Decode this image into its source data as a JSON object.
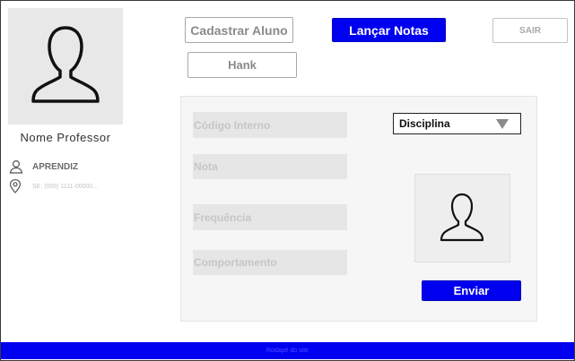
{
  "profile": {
    "name": "Nome Professor",
    "role": "APRENDIZ",
    "location": "SE: (000) 1111-00000..."
  },
  "buttons": {
    "cadastrar": "Cadastrar Aluno",
    "lancar": "Lançar Notas",
    "sair": "SAIR",
    "hank": "Hank",
    "enviar": "Enviar"
  },
  "form": {
    "codigo_placeholder": "Código Interno",
    "nota_placeholder": "Nota",
    "frequencia_placeholder": "Frequência",
    "comportamento_placeholder": "Comportamento",
    "disciplina_selected": "Disciplina"
  },
  "footer": {
    "text": "Rodapé do site"
  },
  "colors": {
    "accent": "#0000f0",
    "panel": "#f6f6f6",
    "field": "#e6e6e6"
  },
  "icons": [
    "user-avatar-icon",
    "user-icon",
    "location-pin-icon",
    "chevron-down-icon",
    "student-photo-icon"
  ]
}
